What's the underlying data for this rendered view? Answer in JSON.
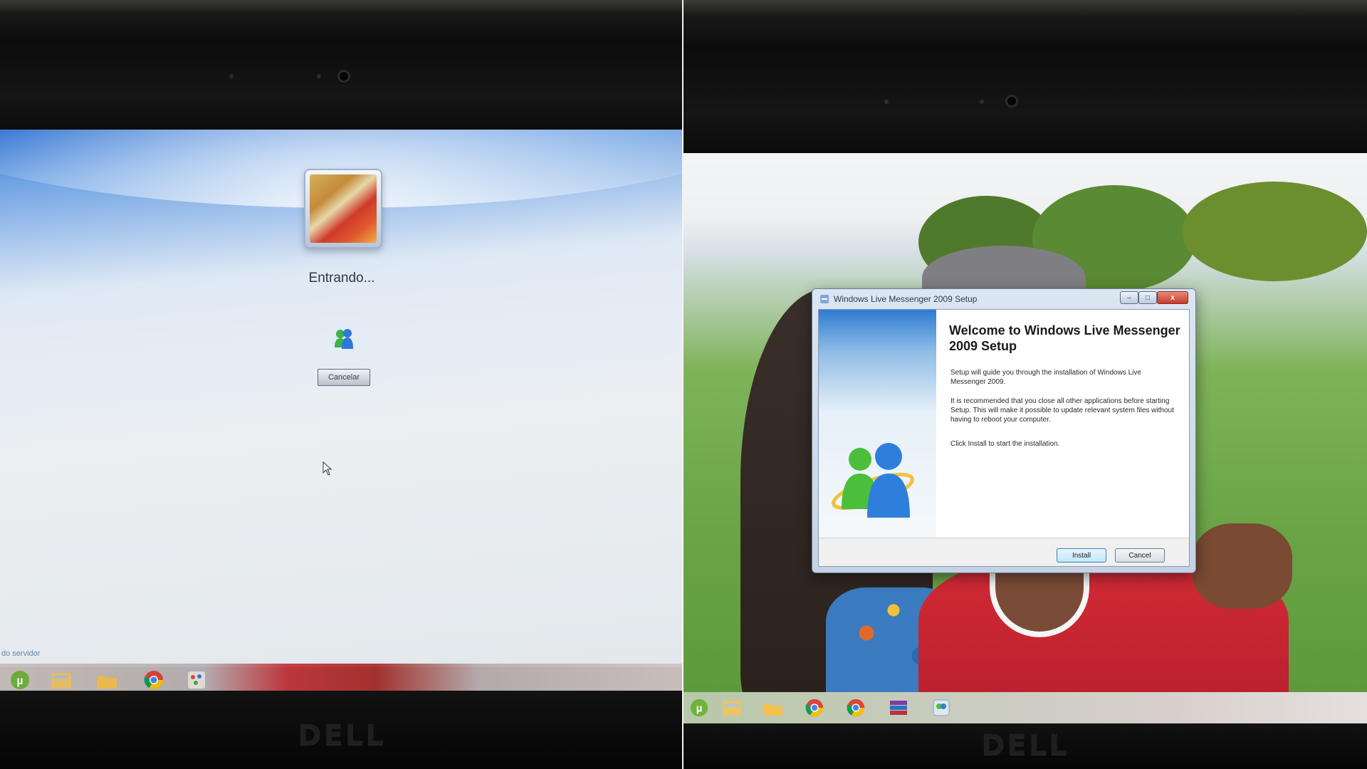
{
  "left_screen": {
    "login_status": "Entrando...",
    "cancel_button": "Cancelar",
    "server_status": "do servidor"
  },
  "right_screen": {
    "dialog": {
      "title": "Windows Live Messenger 2009 Setup",
      "heading": "Welcome to Windows Live Messenger 2009 Setup",
      "paragraph_1": "Setup will guide you through the installation of Windows Live Messenger 2009.",
      "paragraph_2": "It is recommended that you close all other applications before starting Setup. This will make it possible to update relevant system files without having to reboot your computer.",
      "paragraph_3": "Click Install to start the installation.",
      "install_button": "Install",
      "cancel_button": "Cancel",
      "close_glyph": "x",
      "minimize_glyph": "–",
      "maximize_glyph": "□"
    }
  },
  "bezel_brand": "DELL",
  "taskbar": {
    "left_icons": [
      "utorrent-icon",
      "file-explorer-icon",
      "folder-icon",
      "chrome-icon",
      "paint-icon"
    ],
    "right_icons": [
      "utorrent-icon",
      "file-explorer-icon",
      "folder-icon",
      "chrome-icon",
      "chrome-icon",
      "winrar-icon",
      "installer-icon"
    ]
  },
  "colors": {
    "login_blue": "#2c6fd0",
    "taskbar_red": "#c3383e",
    "dialog_close": "#c43c2a",
    "install_button": "#bee6fd"
  }
}
